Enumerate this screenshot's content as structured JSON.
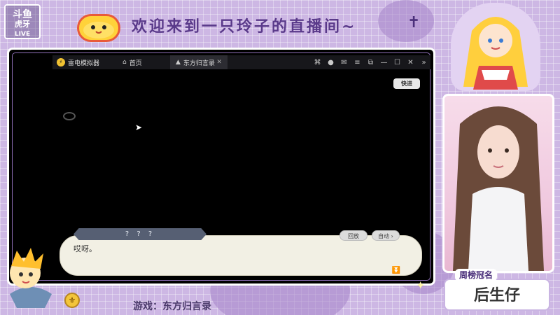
{
  "banner": {
    "welcome_text": "欢迎来到一只玲子的直播间~",
    "logo_text": "斗鱼\n虎牙\n直播"
  },
  "emulator": {
    "app_name": "雷电模拟器",
    "tabs": [
      {
        "label": "首页",
        "icon": "home-icon"
      },
      {
        "label": "东方归言录",
        "icon": "game-icon",
        "close": "✕"
      }
    ],
    "toolbar_icons": [
      "gamepad-icon",
      "user-icon",
      "mail-icon",
      "menu-icon",
      "window-icon",
      "minimize-icon",
      "maximize-icon",
      "close-icon",
      "collapse-icon"
    ]
  },
  "game": {
    "fast_label": "快进",
    "speaker": "? ? ?",
    "dialogue": "哎呀。",
    "history_label": "回放",
    "auto_label": "自动 ›",
    "next_icon": "double-chevron-down-icon"
  },
  "caption": {
    "text": "游戏：东方归言录"
  },
  "name_card": {
    "label": "周榜冠名",
    "value": "后生仔"
  },
  "colors": {
    "background": "#cdb7e4",
    "accent": "#5a3a8a",
    "dialog_bg": "#f2f0e4",
    "speaker_plate": "#565f73"
  }
}
